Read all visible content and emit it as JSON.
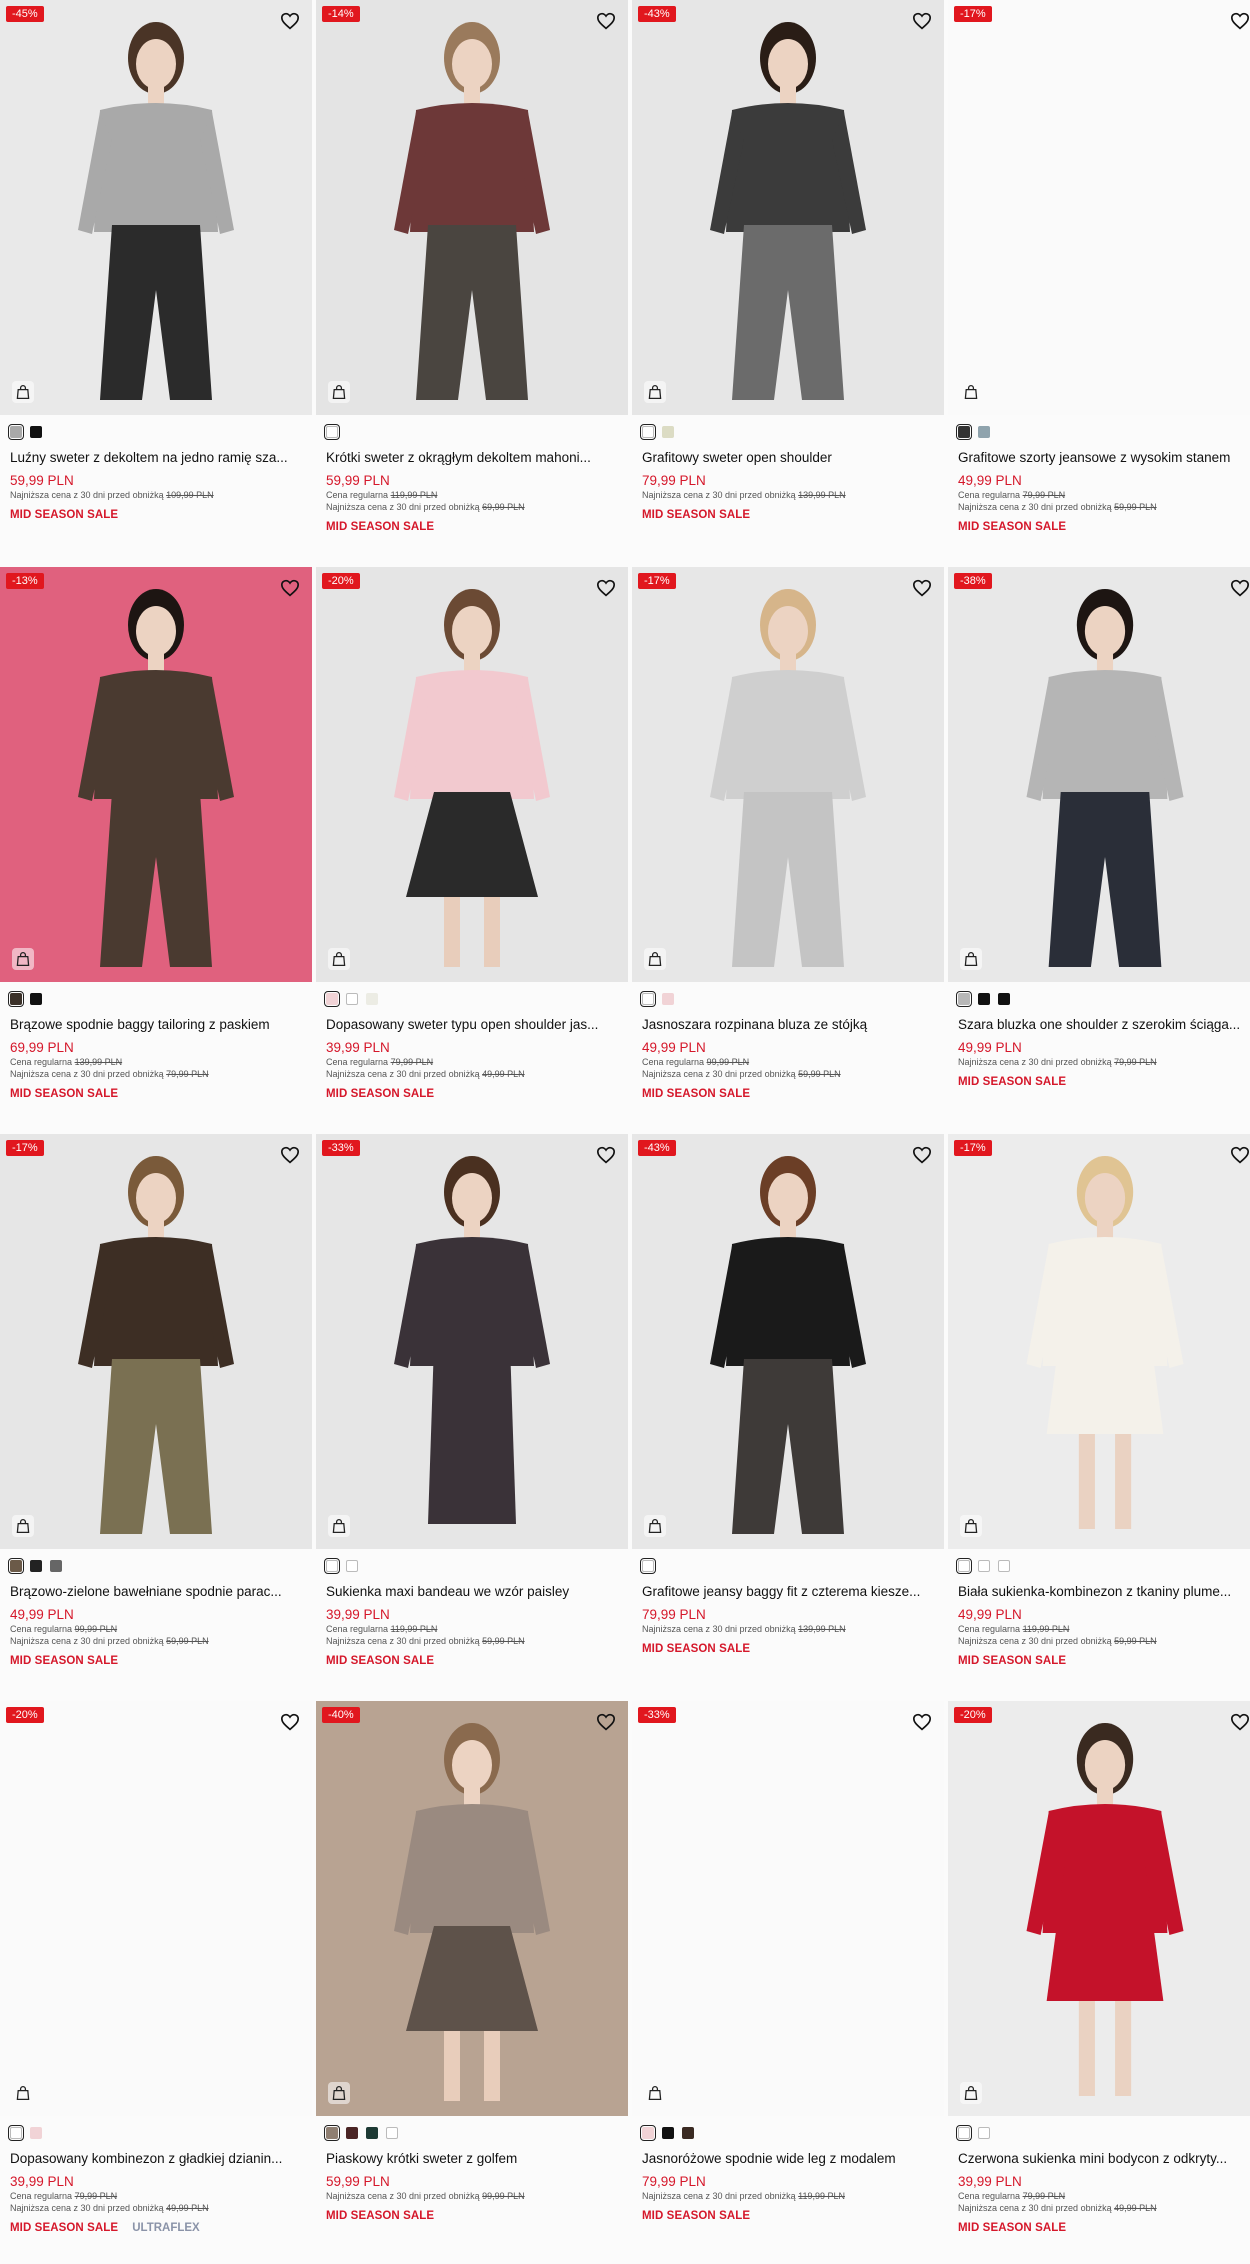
{
  "accent": "#e1171e",
  "price_color": "#d5172a",
  "products": [
    {
      "badge": "-45%",
      "title": "Luźny sweter z dekoltem na jedno ramię sza...",
      "price": "59,99 PLN",
      "regular_label": "",
      "regular_price": "",
      "lowest_label": "Najniższa cena z 30 dni przed obniżką",
      "lowest_price": "109,99 PLN",
      "sale": "MID SEASON SALE",
      "tag": "",
      "bg": "#e9e9e9",
      "swatches": [
        "#a9a9a9",
        "#111111"
      ],
      "bag_icon": "shopping-bag-icon"
    },
    {
      "badge": "-14%",
      "title": "Krótki sweter z okrągłym dekoltem mahoni...",
      "price": "59,99 PLN",
      "regular_label": "Cena regularna",
      "regular_price": "119,99 PLN",
      "lowest_label": "Najniższa cena z 30 dni przed obniżką",
      "lowest_price": "69,99 PLN",
      "sale": "MID SEASON SALE",
      "tag": "",
      "bg": "#e4e4e4",
      "swatches": [
        "#ffffff"
      ],
      "bag_icon": "shopping-bag-icon"
    },
    {
      "badge": "-43%",
      "title": "Grafitowy sweter open shoulder",
      "price": "79,99 PLN",
      "regular_label": "",
      "regular_price": "",
      "lowest_label": "Najniższa cena z 30 dni przed obniżką",
      "lowest_price": "139,99 PLN",
      "sale": "MID SEASON SALE",
      "tag": "",
      "bg": "#e6e6e6",
      "swatches": [
        "#ffffff",
        "#dcdcc4"
      ],
      "bag_icon": "shopping-bag-icon"
    },
    {
      "badge": "-17%",
      "title": "Grafitowe szorty jeansowe z wysokim stanem",
      "price": "49,99 PLN",
      "regular_label": "Cena regularna",
      "regular_price": "79,99 PLN",
      "lowest_label": "Najniższa cena z 30 dni przed obniżką",
      "lowest_price": "59,99 PLN",
      "sale": "MID SEASON SALE",
      "tag": "",
      "bg": "#fafafa",
      "swatches": [
        "#333333",
        "#8fa3ad"
      ],
      "bag_icon": "shopping-bag-icon"
    },
    {
      "badge": "-13%",
      "title": "Brązowe spodnie baggy tailoring z paskiem",
      "price": "69,99 PLN",
      "regular_label": "Cena regularna",
      "regular_price": "139,99 PLN",
      "lowest_label": "Najniższa cena z 30 dni przed obniżką",
      "lowest_price": "79,99 PLN",
      "sale": "MID SEASON SALE",
      "tag": "",
      "bg": "#e0617e",
      "swatches": [
        "#3b3129",
        "#111111"
      ],
      "bag_icon": "shopping-bag-icon"
    },
    {
      "badge": "-20%",
      "title": "Dopasowany sweter typu open shoulder jas...",
      "price": "39,99 PLN",
      "regular_label": "Cena regularna",
      "regular_price": "79,99 PLN",
      "lowest_label": "Najniższa cena z 30 dni przed obniżką",
      "lowest_price": "49,99 PLN",
      "sale": "MID SEASON SALE",
      "tag": "",
      "bg": "#e5e5e5",
      "swatches": [
        "#f1d3d6",
        "#ffffff",
        "#ecece4"
      ],
      "bag_icon": "shopping-bag-icon"
    },
    {
      "badge": "-17%",
      "title": "Jasnoszara rozpinana bluza ze stójką",
      "price": "49,99 PLN",
      "regular_label": "Cena regularna",
      "regular_price": "99,99 PLN",
      "lowest_label": "Najniższa cena z 30 dni przed obniżką",
      "lowest_price": "59,99 PLN",
      "sale": "MID SEASON SALE",
      "tag": "",
      "bg": "#e7e7e7",
      "swatches": [
        "#ffffff",
        "#f1d3d6"
      ],
      "bag_icon": "shopping-bag-icon"
    },
    {
      "badge": "-38%",
      "title": "Szara bluzka one shoulder z szerokim ściąga...",
      "price": "49,99 PLN",
      "regular_label": "",
      "regular_price": "",
      "lowest_label": "Najniższa cena z 30 dni przed obniżką",
      "lowest_price": "79,99 PLN",
      "sale": "MID SEASON SALE",
      "tag": "",
      "bg": "#e8e8e8",
      "swatches": [
        "#b7b7b7",
        "#111111",
        "#111111"
      ],
      "bag_icon": "shopping-bag-icon"
    },
    {
      "badge": "-17%",
      "title": "Brązowo-zielone bawełniane spodnie parac...",
      "price": "49,99 PLN",
      "regular_label": "Cena regularna",
      "regular_price": "99,99 PLN",
      "lowest_label": "Najniższa cena z 30 dni przed obniżką",
      "lowest_price": "59,99 PLN",
      "sale": "MID SEASON SALE",
      "tag": "",
      "bg": "#e6e6e6",
      "swatches": [
        "#6b5a48",
        "#222222",
        "#666666"
      ],
      "bag_icon": "shopping-bag-icon"
    },
    {
      "badge": "-33%",
      "title": "Sukienka maxi bandeau we wzór paisley",
      "price": "39,99 PLN",
      "regular_label": "Cena regularna",
      "regular_price": "119,99 PLN",
      "lowest_label": "Najniższa cena z 30 dni przed obniżką",
      "lowest_price": "59,99 PLN",
      "sale": "MID SEASON SALE",
      "tag": "",
      "bg": "#e6e6e6",
      "swatches": [
        "#ffffff",
        "#ffffff"
      ],
      "bag_icon": "shopping-bag-icon"
    },
    {
      "badge": "-43%",
      "title": "Grafitowe jeansy baggy fit z czterema kiesze...",
      "price": "79,99 PLN",
      "regular_label": "",
      "regular_price": "",
      "lowest_label": "Najniższa cena z 30 dni przed obniżką",
      "lowest_price": "139,99 PLN",
      "sale": "MID SEASON SALE",
      "tag": "",
      "bg": "#e7e7e7",
      "swatches": [
        "#ffffff"
      ],
      "bag_icon": "shopping-bag-icon"
    },
    {
      "badge": "-17%",
      "title": "Biała sukienka-kombinezon z tkaniny plume...",
      "price": "49,99 PLN",
      "regular_label": "Cena regularna",
      "regular_price": "119,99 PLN",
      "lowest_label": "Najniższa cena z 30 dni przed obniżką",
      "lowest_price": "59,99 PLN",
      "sale": "MID SEASON SALE",
      "tag": "",
      "bg": "#ececec",
      "swatches": [
        "#ffffff",
        "#ffffff",
        "#ffffff"
      ],
      "bag_icon": "shopping-bag-icon"
    },
    {
      "badge": "-20%",
      "title": "Dopasowany kombinezon z gładkiej dzianin...",
      "price": "39,99 PLN",
      "regular_label": "Cena regularna",
      "regular_price": "79,99 PLN",
      "lowest_label": "Najniższa cena z 30 dni przed obniżką",
      "lowest_price": "49,99 PLN",
      "sale": "MID SEASON SALE",
      "tag": "ULTRAFLEX",
      "bg": "#fafafa",
      "swatches": [
        "#ffffff",
        "#f1d3d6"
      ],
      "bag_icon": "shopping-bag-icon"
    },
    {
      "badge": "-40%",
      "title": "Piaskowy krótki sweter z golfem",
      "price": "59,99 PLN",
      "regular_label": "",
      "regular_price": "",
      "lowest_label": "Najniższa cena z 30 dni przed obniżką",
      "lowest_price": "99,99 PLN",
      "sale": "MID SEASON SALE",
      "tag": "",
      "bg": "#b8a392",
      "swatches": [
        "#8f7f72",
        "#4a2424",
        "#1d3a34",
        "#ffffff"
      ],
      "bag_icon": "shopping-bag-icon"
    },
    {
      "badge": "-33%",
      "title": "Jasnoróżowe spodnie wide leg z modalem",
      "price": "79,99 PLN",
      "regular_label": "",
      "regular_price": "",
      "lowest_label": "Najniższa cena z 30 dni przed obniżką",
      "lowest_price": "119,99 PLN",
      "sale": "MID SEASON SALE",
      "tag": "",
      "bg": "#fafafa",
      "swatches": [
        "#f1d3d6",
        "#111111",
        "#3a2a22"
      ],
      "bag_icon": "shopping-bag-icon"
    },
    {
      "badge": "-20%",
      "title": "Czerwona sukienka mini bodycon z odkryty...",
      "price": "39,99 PLN",
      "regular_label": "Cena regularna",
      "regular_price": "79,99 PLN",
      "lowest_label": "Najniższa cena z 30 dni przed obniżką",
      "lowest_price": "49,99 PLN",
      "sale": "MID SEASON SALE",
      "tag": "",
      "bg": "#ececec",
      "swatches": [
        "#ffffff",
        "#ffffff"
      ],
      "bag_icon": "shopping-bag-icon"
    }
  ]
}
